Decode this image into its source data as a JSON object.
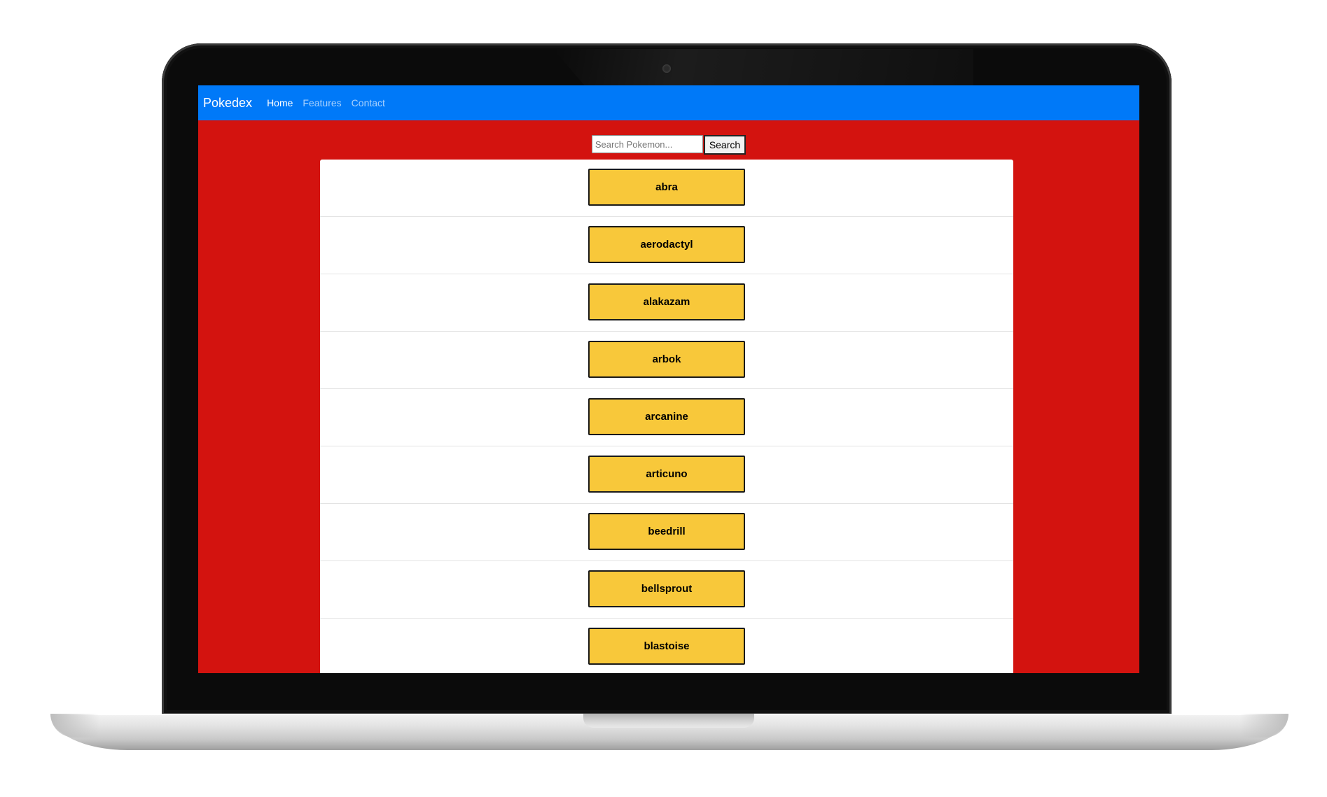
{
  "navbar": {
    "brand": "Pokedex",
    "links": [
      {
        "label": "Home",
        "active": true
      },
      {
        "label": "Features",
        "active": false
      },
      {
        "label": "Contact",
        "active": false
      }
    ],
    "color": "#0079f8"
  },
  "search": {
    "placeholder": "Search Pokemon...",
    "value": "",
    "button_label": "Search"
  },
  "pokemon_list": [
    "abra",
    "aerodactyl",
    "alakazam",
    "arbok",
    "arcanine",
    "articuno",
    "beedrill",
    "bellsprout",
    "blastoise"
  ],
  "colors": {
    "page_background": "#d3130f",
    "button_fill": "#f8c83a",
    "panel": "#ffffff"
  }
}
